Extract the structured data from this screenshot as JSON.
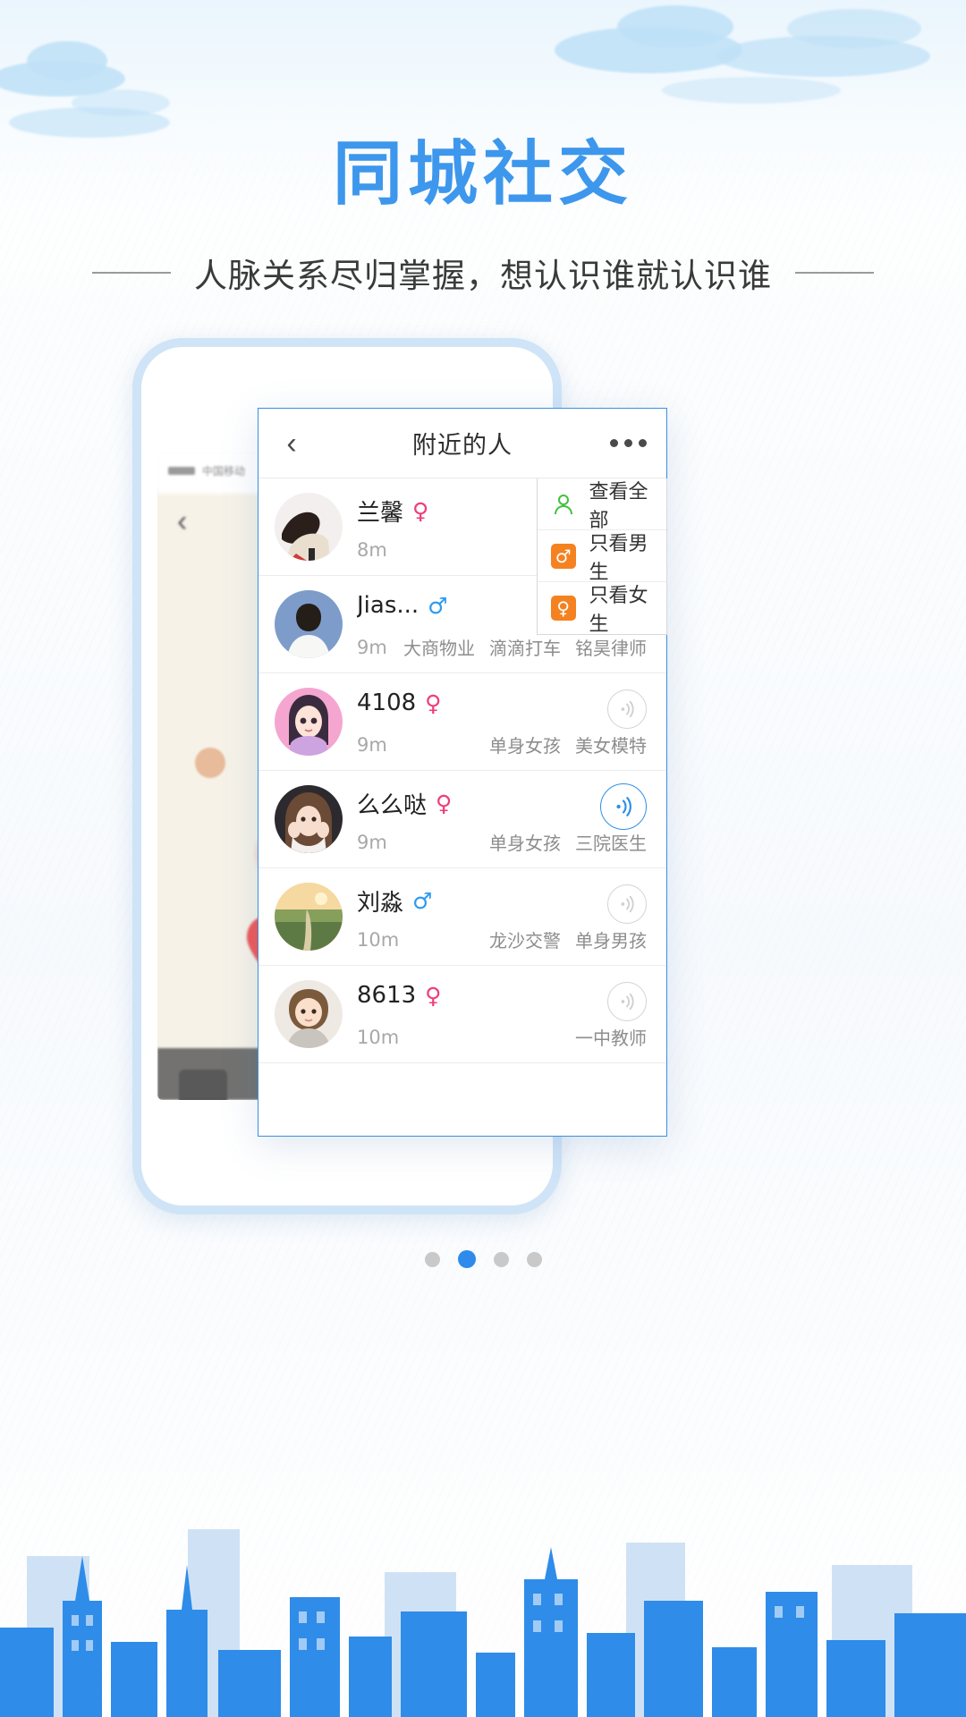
{
  "hero": {
    "title": "同城社交",
    "subtitle": "人脉关系尽归掌握，想认识谁就认识谁",
    "title_color": "#3d97ec"
  },
  "phone_map": {
    "status_carrier": "中国移动",
    "back_icon": "chevron-left-icon"
  },
  "app": {
    "header": {
      "back_icon": "chevron-left-icon",
      "title": "附近的人",
      "more_icon": "more-horizontal-icon"
    },
    "filter_menu": {
      "items": [
        {
          "icon": "person-outline-icon",
          "label": "查看全部",
          "color": "#3ec13e"
        },
        {
          "icon": "male-icon",
          "label": "只看男生",
          "color": "#f58220"
        },
        {
          "icon": "female-icon",
          "label": "只看女生",
          "color": "#f58220"
        }
      ]
    },
    "people": [
      {
        "name": "兰馨",
        "gender": "female",
        "gender_symbol": "♀",
        "distance": "8m",
        "tags": [],
        "sonar": "none",
        "avatar": "woman-photo"
      },
      {
        "name": "Jias...",
        "gender": "male",
        "gender_symbol": "♂",
        "distance": "9m",
        "tags": [
          "大商物业",
          "滴滴打车",
          "铭昊律师"
        ],
        "sonar": "none",
        "avatar": "man-photo"
      },
      {
        "name": "4108",
        "gender": "female",
        "gender_symbol": "♀",
        "distance": "9m",
        "tags": [
          "单身女孩",
          "美女模特"
        ],
        "sonar": "inactive",
        "avatar": "anime-girl"
      },
      {
        "name": "么么哒",
        "gender": "female",
        "gender_symbol": "♀",
        "distance": "9m",
        "tags": [
          "单身女孩",
          "三院医生"
        ],
        "sonar": "active",
        "avatar": "girl-photo"
      },
      {
        "name": "刘淼",
        "gender": "male",
        "gender_symbol": "♂",
        "distance": "10m",
        "tags": [
          "龙沙交警",
          "单身男孩"
        ],
        "sonar": "inactive",
        "avatar": "landscape-photo"
      },
      {
        "name": "8613",
        "gender": "female",
        "gender_symbol": "♀",
        "distance": "10m",
        "tags": [
          "一中教师"
        ],
        "sonar": "inactive",
        "avatar": "child-photo"
      }
    ]
  },
  "pagination": {
    "total": 4,
    "active_index": 1
  }
}
